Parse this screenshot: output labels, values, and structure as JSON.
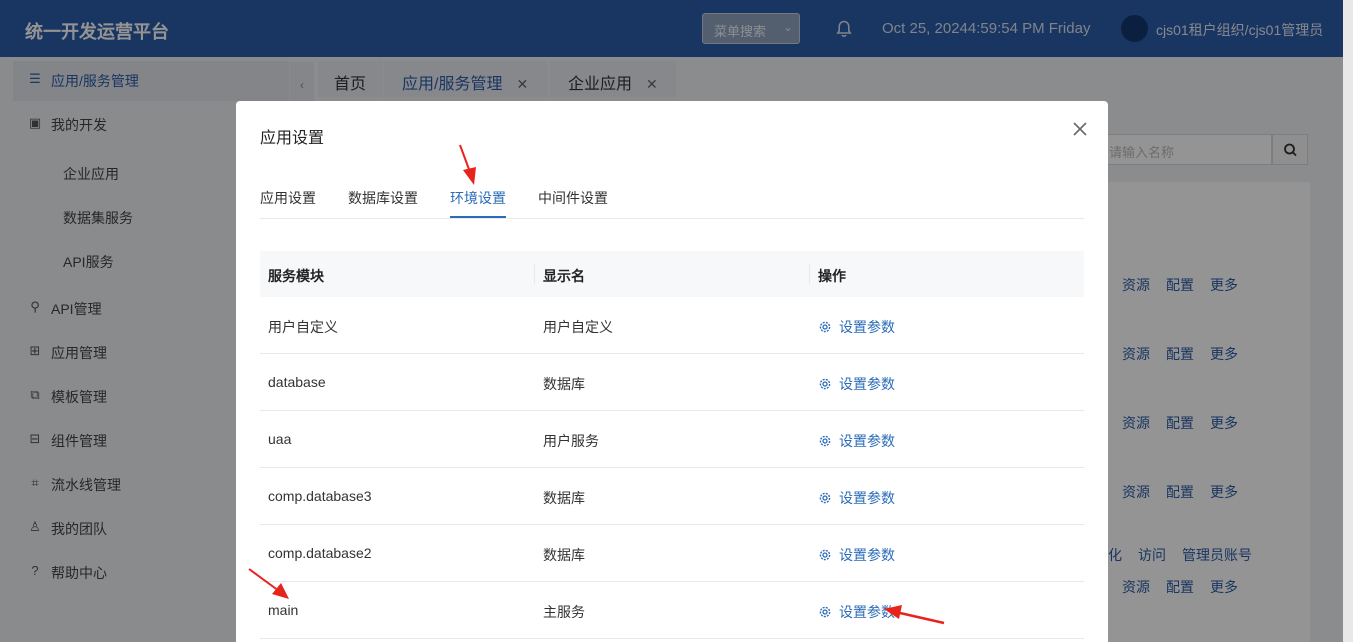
{
  "header": {
    "brand": "统一开发运营平台",
    "menu_search": "菜单搜索",
    "datetime": "Oct 25, 20244:59:54 PM Friday",
    "user": "cjs01租户组织/cjs01管理员"
  },
  "sidebar": {
    "items": [
      {
        "label": "应用/服务管理",
        "icon": "list-icon"
      },
      {
        "label": "我的开发",
        "icon": "calendar-icon"
      },
      {
        "label": "API管理",
        "icon": "link-icon"
      },
      {
        "label": "应用管理",
        "icon": "grid-icon"
      },
      {
        "label": "模板管理",
        "icon": "copy-icon"
      },
      {
        "label": "组件管理",
        "icon": "components-icon"
      },
      {
        "label": "流水线管理",
        "icon": "pipeline-icon"
      },
      {
        "label": "我的团队",
        "icon": "team-icon"
      },
      {
        "label": "帮助中心",
        "icon": "help-icon"
      }
    ],
    "sub_items": [
      "企业应用",
      "数据集服务",
      "API服务"
    ]
  },
  "tabs": [
    {
      "label": "首页"
    },
    {
      "label": "应用/服务管理"
    },
    {
      "label": "企业应用"
    }
  ],
  "background": {
    "search_placeholder": "请输入名称",
    "row_actions": [
      "资源",
      "配置",
      "更多"
    ],
    "extra_actions": [
      "化",
      "访问",
      "管理员账号"
    ]
  },
  "modal": {
    "title": "应用设置",
    "tabs": [
      "应用设置",
      "数据库设置",
      "环境设置",
      "中间件设置"
    ],
    "active_tab": "环境设置",
    "columns": [
      "服务模块",
      "显示名",
      "操作"
    ],
    "rows": [
      {
        "module": "用户自定义",
        "display": "用户自定义",
        "action": "设置参数"
      },
      {
        "module": "database",
        "display": "数据库",
        "action": "设置参数"
      },
      {
        "module": "uaa",
        "display": "用户服务",
        "action": "设置参数"
      },
      {
        "module": "comp.database3",
        "display": "数据库",
        "action": "设置参数"
      },
      {
        "module": "comp.database2",
        "display": "数据库",
        "action": "设置参数"
      },
      {
        "module": "main",
        "display": "主服务",
        "action": "设置参数"
      }
    ]
  },
  "colors": {
    "header_bg": "#2b5ca8",
    "link": "#2b6cb8",
    "annotation": "#e8231c"
  }
}
